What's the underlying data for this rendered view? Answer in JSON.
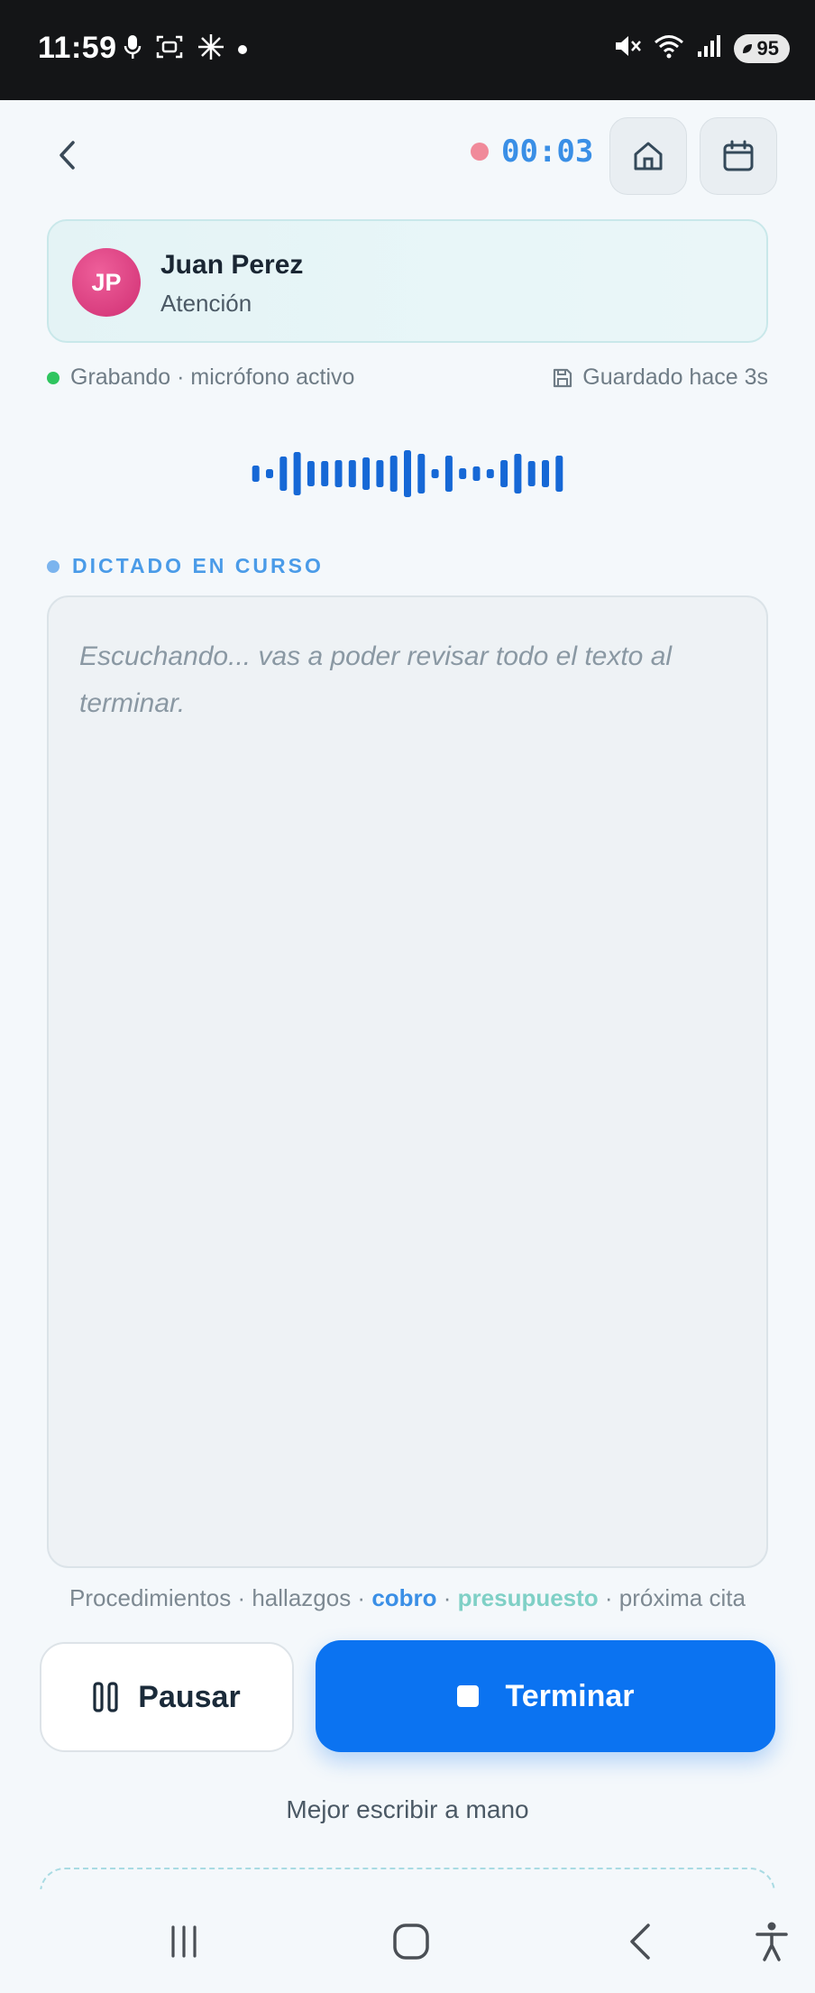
{
  "status_bar": {
    "time": "11:59",
    "battery": "95",
    "icons_left": [
      "mic-icon",
      "screen-record-icon",
      "sparkle-icon",
      "dot-icon"
    ],
    "icons_right": [
      "mute-icon",
      "wifi-icon",
      "signal-icon",
      "battery-icon"
    ]
  },
  "header": {
    "timer": "00:03",
    "home_icon": "home-icon",
    "calendar_icon": "calendar-icon",
    "back_icon": "chevron-left-icon"
  },
  "patient": {
    "initials": "JP",
    "name": "Juan Perez",
    "type": "Atención",
    "avatar_color": "#d83b7c"
  },
  "status": {
    "recording": "Grabando · micrófono activo",
    "saved": "Guardado hace 3s"
  },
  "dictation": {
    "label": "DICTADO EN CURSO",
    "placeholder": "Escuchando... vas a poder revisar todo el texto al terminar."
  },
  "keywords": {
    "k1": "Procedimientos",
    "sep": " · ",
    "k2": "hallazgos",
    "k3": "cobro",
    "k4": "presupuesto",
    "k5": "próxima cita"
  },
  "actions": {
    "pause": "Pausar",
    "finish": "Terminar",
    "write_manual": "Mejor escribir a mano"
  },
  "colors": {
    "primary": "#0b73f1",
    "timer": "#3a8fe6",
    "recording_dot": "#f08a9a",
    "active_green": "#2fc55f",
    "accent_teal": "#7fd0c6"
  }
}
